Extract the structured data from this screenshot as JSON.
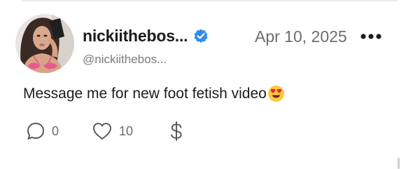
{
  "post": {
    "display_name": "nickiithebos...",
    "handle": "@nickiithebos...",
    "date": "Apr 10, 2025",
    "text": "Message me for new foot fetish video",
    "emoji": "heart-eyes-icon",
    "verified_icon": "verified-badge-icon",
    "more_icon": "more-options-icon"
  },
  "actions": {
    "comments": {
      "icon": "comment-icon",
      "count": "0"
    },
    "likes": {
      "icon": "heart-icon",
      "count": "10"
    },
    "tip": {
      "icon": "dollar-icon",
      "label": "$"
    }
  },
  "colors": {
    "verified_badge": "#2f8cf0",
    "emoji_face": "#ffc83d",
    "emoji_hearts": "#e8283c",
    "muted_text": "#6e6e6e"
  }
}
